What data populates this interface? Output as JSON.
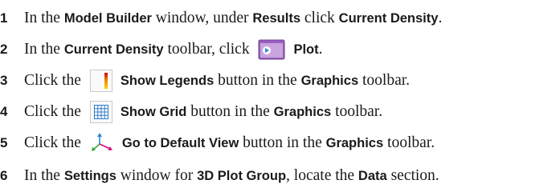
{
  "steps": [
    {
      "num": "1",
      "parts": [
        {
          "t": "In the ",
          "b": false
        },
        {
          "t": "Model Builder",
          "b": true
        },
        {
          "t": " window, under ",
          "b": false
        },
        {
          "t": "Results",
          "b": true
        },
        {
          "t": " click ",
          "b": false
        },
        {
          "t": "Current Density",
          "b": true
        },
        {
          "t": ".",
          "b": false
        }
      ]
    },
    {
      "num": "2",
      "parts": [
        {
          "t": "In the ",
          "b": false
        },
        {
          "t": "Current Density",
          "b": true
        },
        {
          "t": " toolbar, click ",
          "b": false
        },
        {
          "icon": "plot-icon"
        },
        {
          "t": "Plot",
          "b": true
        },
        {
          "t": ".",
          "b": false
        }
      ]
    },
    {
      "num": "3",
      "parts": [
        {
          "t": "Click the ",
          "b": false
        },
        {
          "icon": "show-legends-icon"
        },
        {
          "t": "Show Legends",
          "b": true
        },
        {
          "t": " button in the ",
          "b": false
        },
        {
          "t": "Graphics",
          "b": true
        },
        {
          "t": " toolbar.",
          "b": false
        }
      ]
    },
    {
      "num": "4",
      "parts": [
        {
          "t": "Click the ",
          "b": false
        },
        {
          "icon": "show-grid-icon"
        },
        {
          "t": "Show Grid",
          "b": true
        },
        {
          "t": " button in the ",
          "b": false
        },
        {
          "t": "Graphics",
          "b": true
        },
        {
          "t": " toolbar.",
          "b": false
        }
      ]
    },
    {
      "num": "5",
      "parts": [
        {
          "t": "Click the ",
          "b": false
        },
        {
          "icon": "go-to-default-view-icon"
        },
        {
          "t": "Go to Default View",
          "b": true
        },
        {
          "t": " button in the ",
          "b": false
        },
        {
          "t": "Graphics",
          "b": true
        },
        {
          "t": " toolbar.",
          "b": false
        }
      ]
    },
    {
      "num": "6",
      "parts": [
        {
          "t": "In the ",
          "b": false
        },
        {
          "t": "Settings",
          "b": true
        },
        {
          "t": " window for ",
          "b": false
        },
        {
          "t": "3D Plot Group",
          "b": true
        },
        {
          "t": ", locate the ",
          "b": false
        },
        {
          "t": "Data",
          "b": true
        },
        {
          "t": " section.",
          "b": false
        }
      ]
    }
  ]
}
